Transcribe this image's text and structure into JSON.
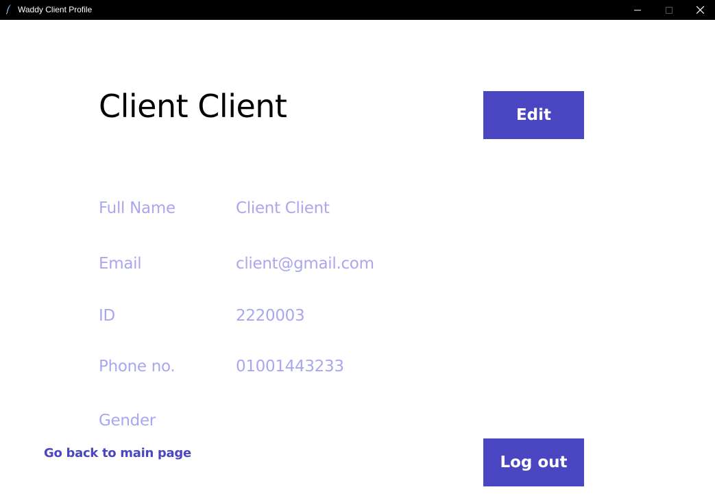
{
  "window": {
    "title": "Waddy Client Profile",
    "controls": {
      "minimize_icon": "minimize-icon",
      "maximize_icon": "maximize-icon",
      "close_icon": "close-icon"
    }
  },
  "profile": {
    "heading": "Client Client",
    "edit_label": "Edit",
    "fields": {
      "full_name": {
        "label": "Full Name",
        "value": "Client Client"
      },
      "email": {
        "label": "Email",
        "value": "client@gmail.com"
      },
      "id": {
        "label": "ID",
        "value": "2220003"
      },
      "phone": {
        "label": "Phone no.",
        "value": "01001443233"
      },
      "gender": {
        "label": "Gender",
        "value": ""
      }
    }
  },
  "footer": {
    "back_label": "Go back to main page",
    "logout_label": "Log out"
  },
  "colors": {
    "accent": "#4a46c1",
    "muted_text": "#aaa6f0",
    "titlebar": "#000000"
  }
}
